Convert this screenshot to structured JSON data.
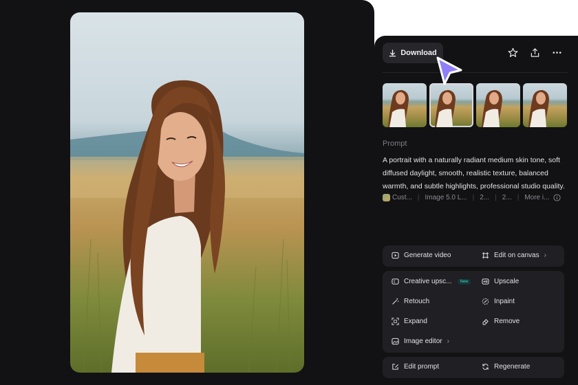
{
  "toolbar": {
    "download_label": "Download",
    "icons": [
      "download-icon",
      "star-icon",
      "share-icon",
      "more-icon"
    ]
  },
  "thumbnails": {
    "count": 4,
    "selected_index": 1
  },
  "prompt": {
    "label": "Prompt",
    "text": "A portrait with a naturally radiant medium skin tone, soft diffused daylight, smooth, realistic texture, balanced warmth, and subtle highlights, professional studio quality."
  },
  "meta": {
    "style": "Cust...",
    "model": "Image 5.0 L...",
    "ratio": "2...",
    "resolution": "2...",
    "more": "More i..."
  },
  "actions": {
    "generate_video": "Generate video",
    "edit_on_canvas": "Edit on canvas",
    "creative_upscale": "Creative upsc...",
    "new_badge": "New",
    "upscale": "Upscale",
    "retouch": "Retouch",
    "inpaint": "Inpaint",
    "expand": "Expand",
    "remove": "Remove",
    "image_editor": "Image editor",
    "edit_prompt": "Edit prompt",
    "regenerate": "Regenerate"
  },
  "colors": {
    "panel_bg": "#121214",
    "group_bg": "#1f1f24",
    "cursor": "#8f80f7",
    "badge": "#3fd3c8"
  }
}
